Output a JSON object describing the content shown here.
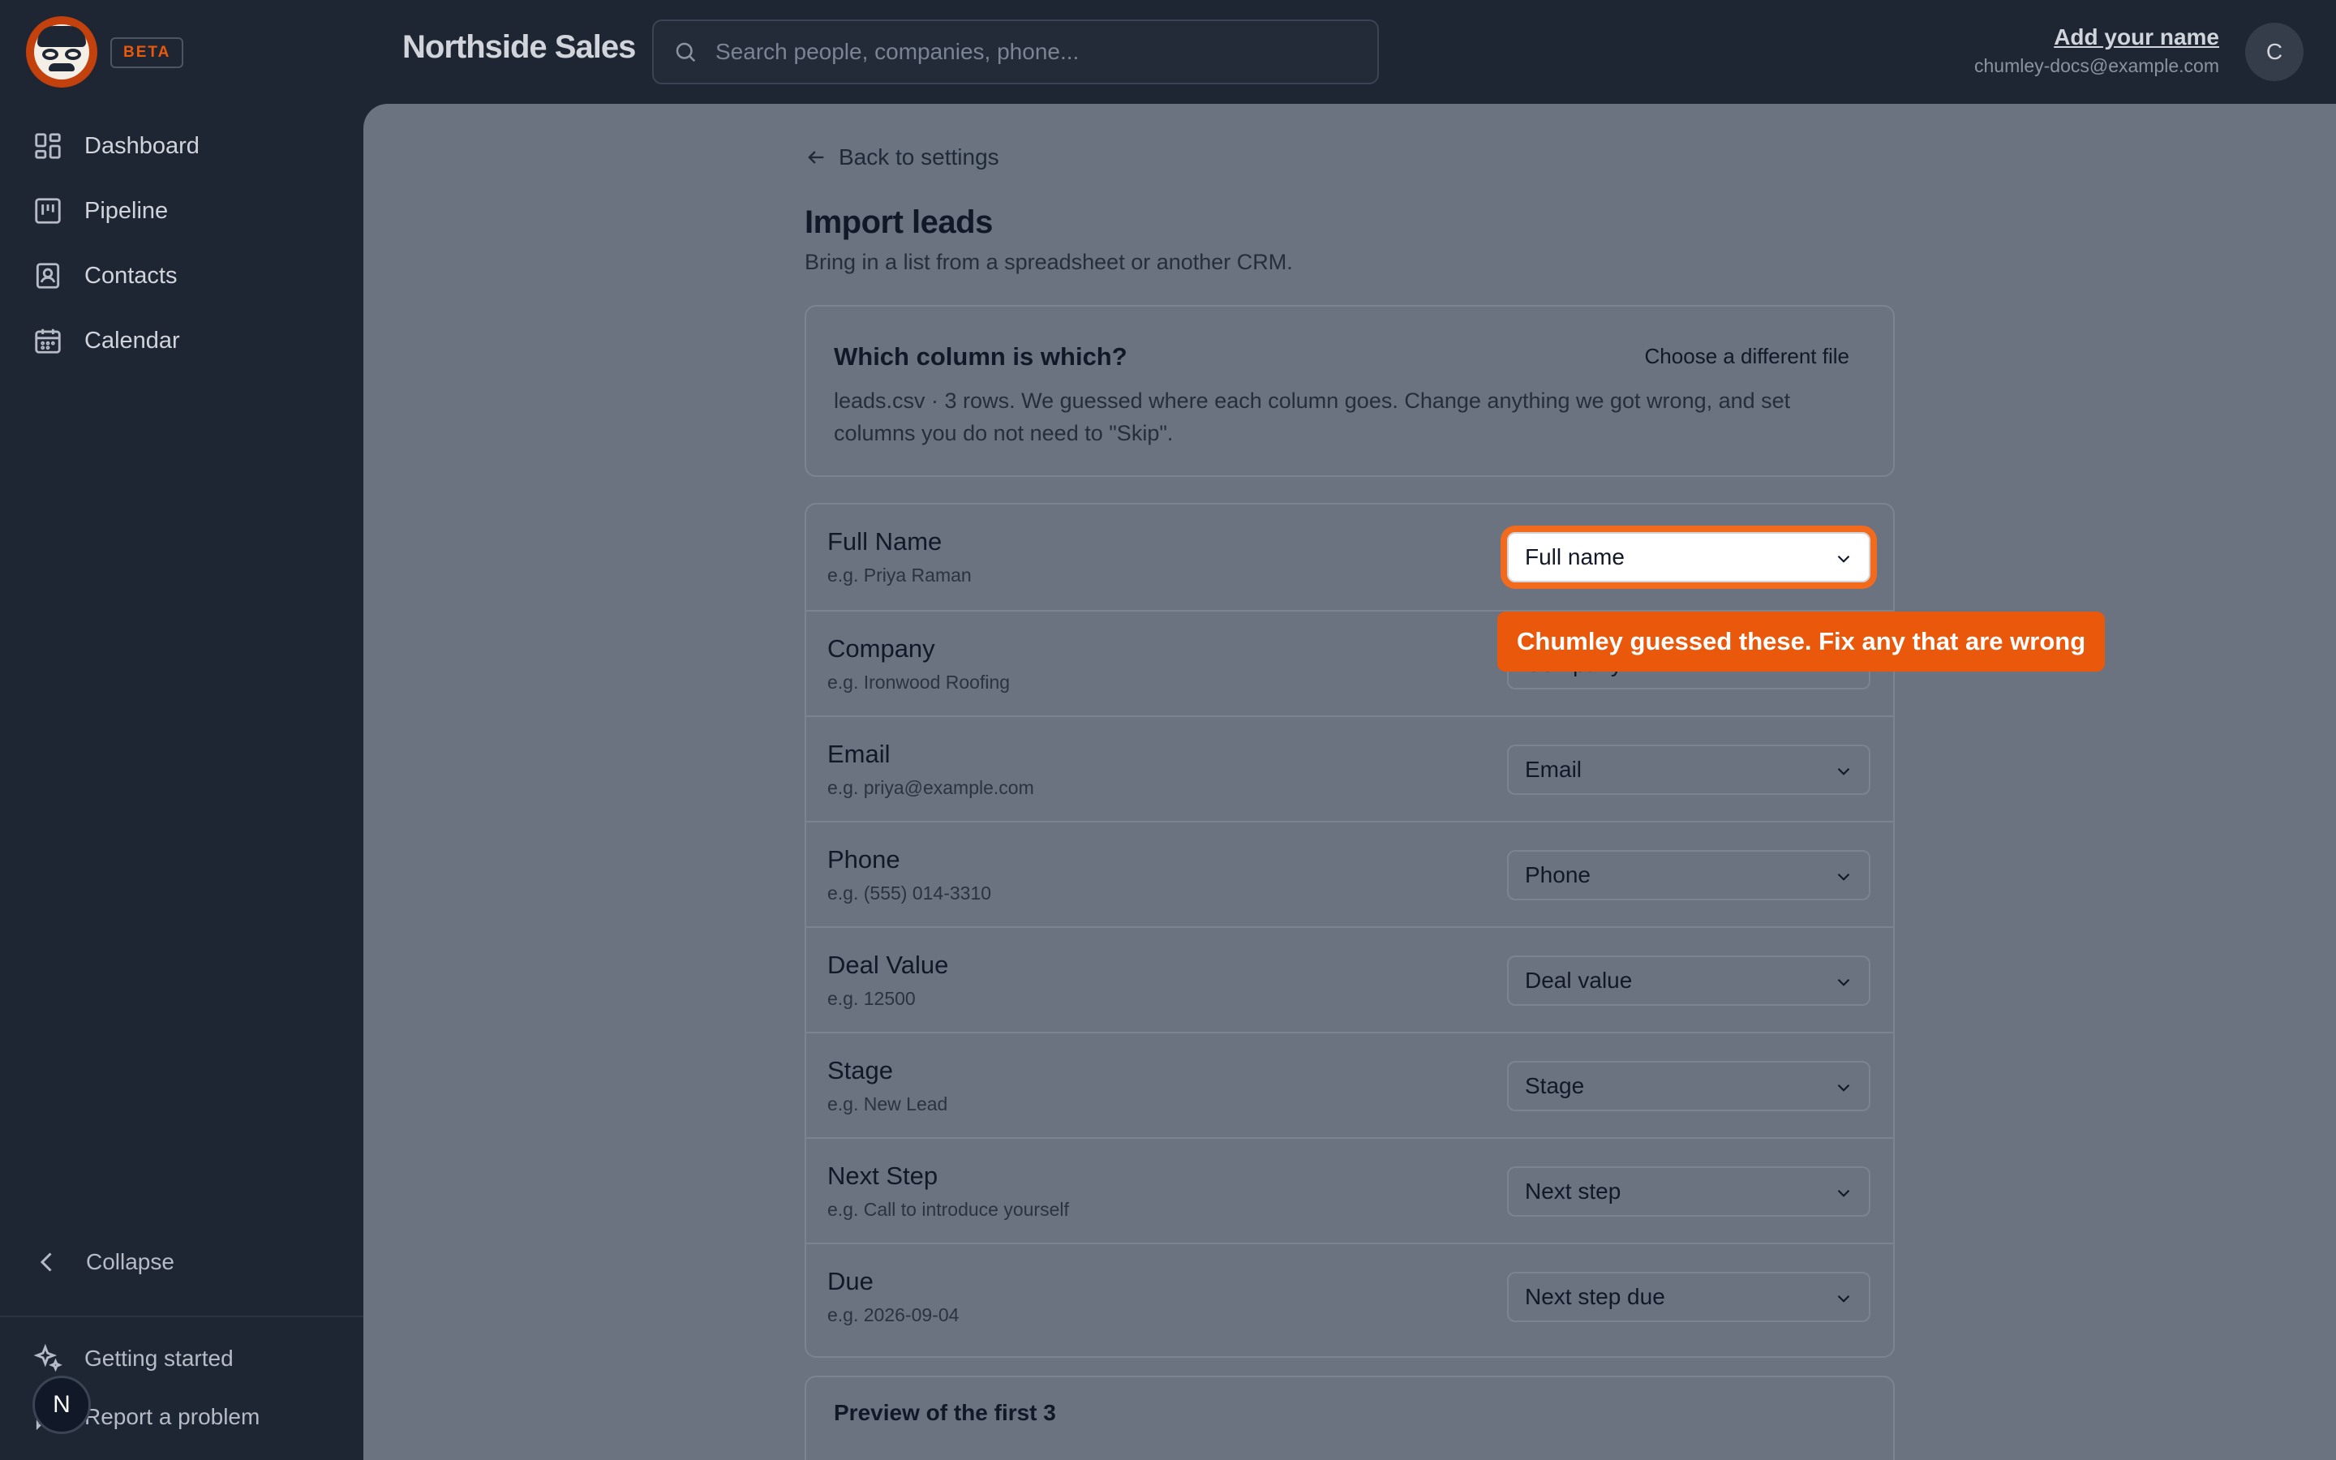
{
  "app": {
    "brand": "Northside Sales",
    "badge": "BETA"
  },
  "search": {
    "placeholder": "Search people, companies, phone..."
  },
  "user": {
    "name": "Add your name",
    "email": "chumley-docs@example.com",
    "initial": "C"
  },
  "sidebar": {
    "items": [
      {
        "label": "Dashboard",
        "icon": "dashboard-icon"
      },
      {
        "label": "Pipeline",
        "icon": "pipeline-icon"
      },
      {
        "label": "Contacts",
        "icon": "contacts-icon"
      },
      {
        "label": "Calendar",
        "icon": "calendar-icon"
      }
    ],
    "collapse": "Collapse",
    "getting_started": "Getting started",
    "report": "Report a problem",
    "n_badge": "N"
  },
  "page": {
    "back": "Back to settings",
    "title": "Import leads",
    "subtitle": "Bring in a list from a spreadsheet or another CRM."
  },
  "mapping_card": {
    "heading": "Which column is which?",
    "change_file": "Choose a different file",
    "description": "leads.csv · 3 rows. We guessed where each column goes. Change anything we got wrong, and set columns you do not need to \"Skip\"."
  },
  "rows": [
    {
      "label": "Full Name",
      "example": "e.g. Priya Raman",
      "value": "Full name"
    },
    {
      "label": "Company",
      "example": "e.g. Ironwood Roofing",
      "value": "Company"
    },
    {
      "label": "Email",
      "example": "e.g. priya@example.com",
      "value": "Email"
    },
    {
      "label": "Phone",
      "example": "e.g. (555) 014-3310",
      "value": "Phone"
    },
    {
      "label": "Deal Value",
      "example": "e.g. 12500",
      "value": "Deal value"
    },
    {
      "label": "Stage",
      "example": "e.g. New Lead",
      "value": "Stage"
    },
    {
      "label": "Next Step",
      "example": "e.g. Call to introduce yourself",
      "value": "Next step"
    },
    {
      "label": "Due",
      "example": "e.g. 2026-09-04",
      "value": "Next step due"
    }
  ],
  "preview": {
    "heading": "Preview of the first 3"
  },
  "tooltip": {
    "text": "Chumley guessed these. Fix any that are wrong"
  },
  "colors": {
    "accent": "#ea580c",
    "sidebar": "#1f2633",
    "overlay": "#6b7280"
  }
}
